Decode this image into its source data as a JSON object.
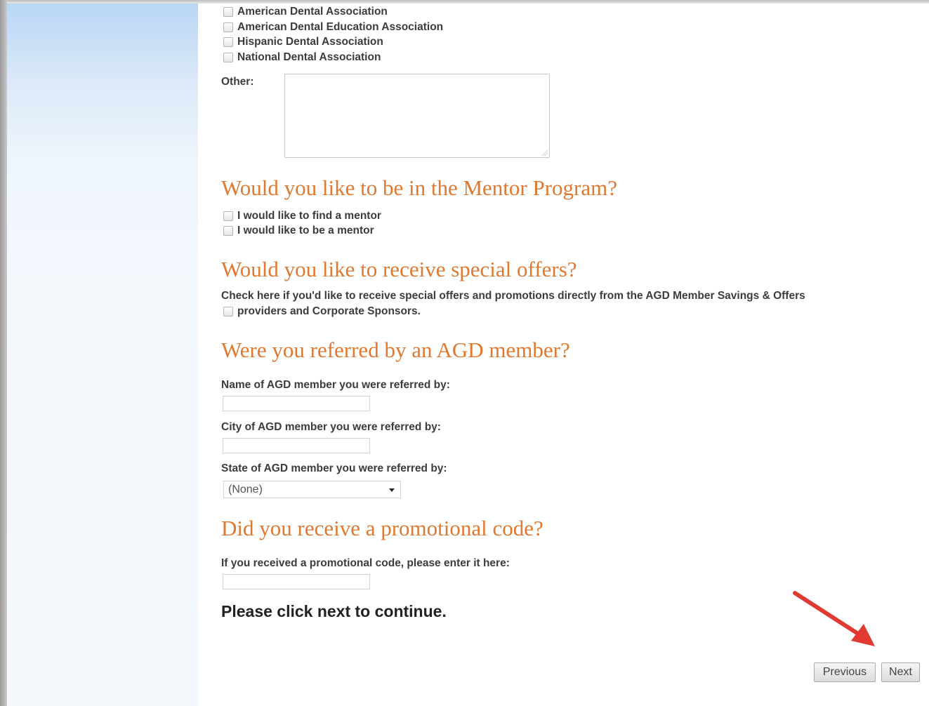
{
  "dental_associations": [
    "American Dental Association",
    "American Dental Education Association",
    "Hispanic Dental Association",
    "National Dental Association"
  ],
  "other_label": "Other:",
  "mentor": {
    "heading": "Would you like to be in the Mentor Program?",
    "options": [
      "I would like to find a mentor",
      "I would like to be a mentor"
    ]
  },
  "offers": {
    "heading": "Would you like to receive special offers?",
    "line1": "Check here if you'd like to receive special offers and promotions directly from the AGD Member Savings & Offers",
    "line2": "providers and Corporate Sponsors."
  },
  "referral": {
    "heading": "Were you referred by an AGD member?",
    "name_label": "Name of AGD member you were referred by:",
    "city_label": "City of AGD member you were referred by:",
    "state_label": "State of AGD member you were referred by:",
    "state_value": "(None)"
  },
  "promo": {
    "heading": "Did you receive a promotional code?",
    "label": "If you received a promotional code, please enter it here:"
  },
  "continue_text": "Please click next to continue.",
  "buttons": {
    "previous": "Previous",
    "next": "Next"
  },
  "colors": {
    "heading": "#e0792f",
    "annotation_arrow": "#e03a32"
  }
}
